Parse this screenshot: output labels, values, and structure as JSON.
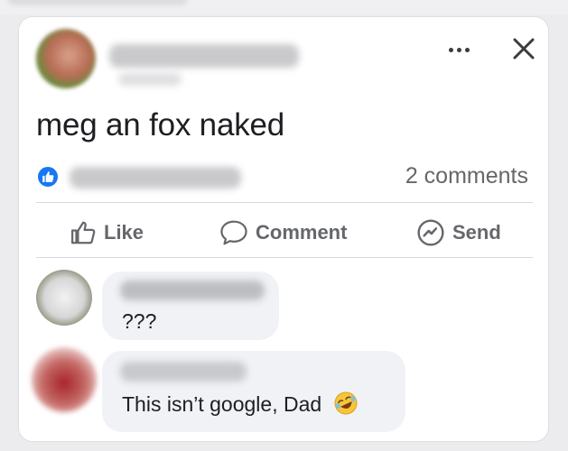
{
  "post": {
    "text": "meg an fox naked",
    "comments_count": "2 comments"
  },
  "actions": {
    "like": "Like",
    "comment": "Comment",
    "send": "Send"
  },
  "comments": [
    {
      "text": "???"
    },
    {
      "text": "This isn’t google, Dad"
    }
  ],
  "colors": {
    "like_blue": "#1877f2",
    "text_primary": "#1c1e21",
    "text_secondary": "#65676b",
    "bubble": "#f0f2f5"
  },
  "icons": {
    "more": "more-icon",
    "close": "close-icon",
    "like_badge": "like-badge-icon",
    "like": "thumbs-up-icon",
    "comment": "comment-icon",
    "send": "messenger-icon",
    "emoji": "rofl-emoji-icon"
  }
}
